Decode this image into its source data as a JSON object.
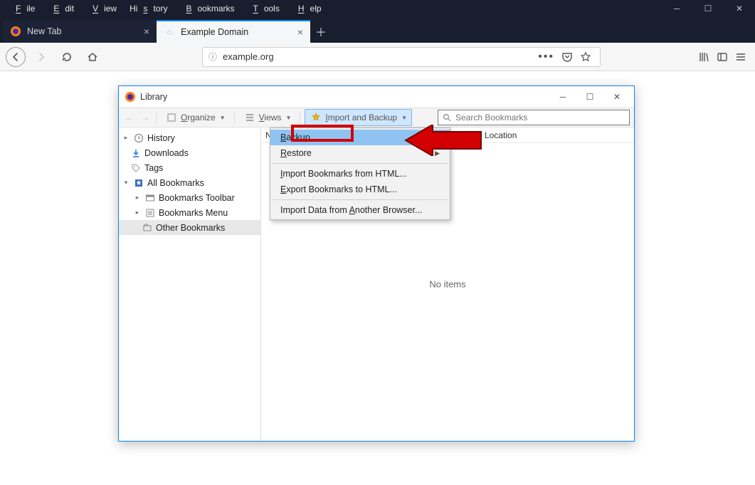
{
  "menubar": {
    "file": "File",
    "edit": "Edit",
    "view": "View",
    "history": "History",
    "bookmarks": "Bookmarks",
    "tools": "Tools",
    "help": "Help"
  },
  "tabs": [
    {
      "label": "New Tab",
      "active": false
    },
    {
      "label": "Example Domain",
      "active": true
    }
  ],
  "url": "example.org",
  "library": {
    "title": "Library",
    "toolbar": {
      "organize": "Organize",
      "views": "Views",
      "import_backup": "Import and Backup",
      "search_placeholder": "Search Bookmarks"
    },
    "tree": {
      "history": "History",
      "downloads": "Downloads",
      "tags": "Tags",
      "all_bookmarks": "All Bookmarks",
      "bookmarks_toolbar": "Bookmarks Toolbar",
      "bookmarks_menu": "Bookmarks Menu",
      "other_bookmarks": "Other Bookmarks"
    },
    "columns": {
      "name": "N",
      "location": "Location"
    },
    "empty": "No items",
    "menu": {
      "backup": "Backup...",
      "restore": "Restore",
      "import_html": "Import Bookmarks from HTML...",
      "export_html": "Export Bookmarks to HTML...",
      "import_browser": "Import Data from Another Browser..."
    }
  }
}
